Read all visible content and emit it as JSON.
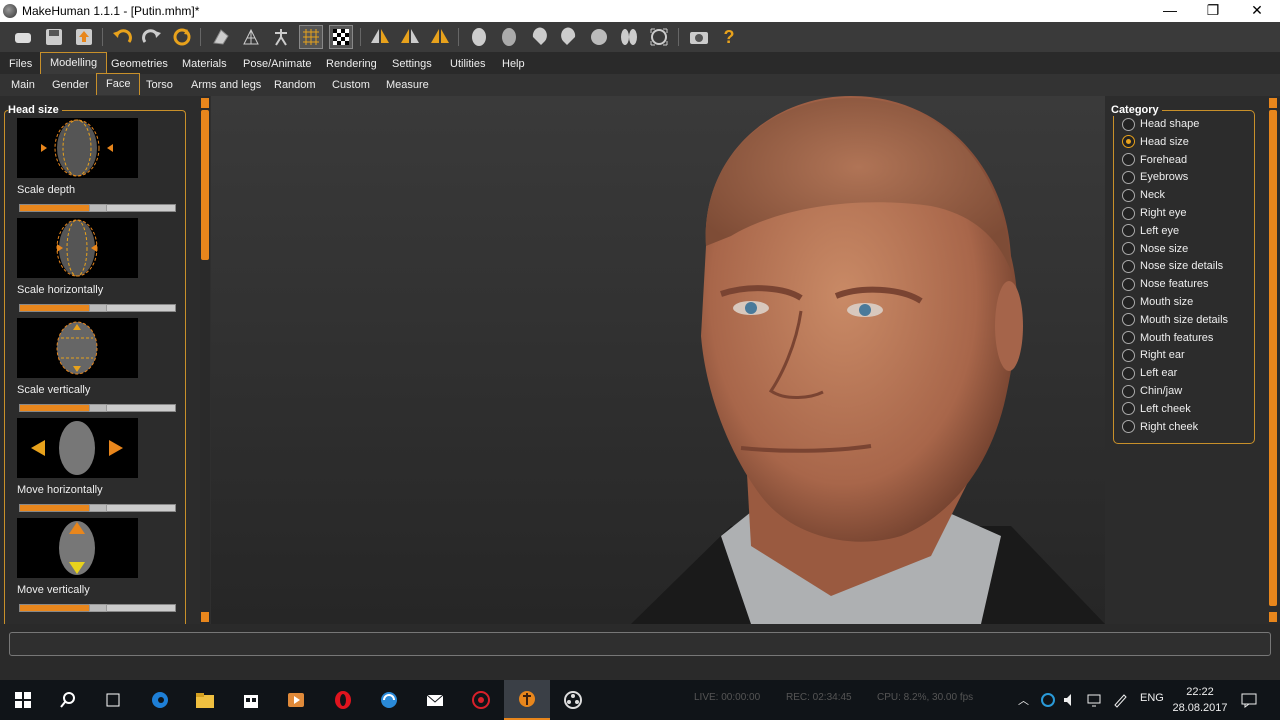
{
  "window": {
    "title": "MakeHuman 1.1.1 - [Putin.mhm]*",
    "minimize": "—",
    "restore": "❐",
    "close": "✕"
  },
  "menu_tabs": [
    {
      "label": "Files"
    },
    {
      "label": "Modelling"
    },
    {
      "label": "Geometries"
    },
    {
      "label": "Materials"
    },
    {
      "label": "Pose/Animate"
    },
    {
      "label": "Rendering"
    },
    {
      "label": "Settings"
    },
    {
      "label": "Utilities"
    },
    {
      "label": "Help"
    }
  ],
  "active_menu_tab": "Modelling",
  "sub_tabs": [
    {
      "label": "Main"
    },
    {
      "label": "Gender"
    },
    {
      "label": "Face"
    },
    {
      "label": "Torso"
    },
    {
      "label": "Arms and legs"
    },
    {
      "label": "Random"
    },
    {
      "label": "Custom"
    },
    {
      "label": "Measure"
    }
  ],
  "active_sub_tab": "Face",
  "left_panel": {
    "title": "Head size",
    "sliders": [
      {
        "label": "Scale depth",
        "value": 0.5
      },
      {
        "label": "Scale horizontally",
        "value": 0.5
      },
      {
        "label": "Scale vertically",
        "value": 0.5
      },
      {
        "label": "Move horizontally",
        "value": 0.5
      },
      {
        "label": "Move vertically",
        "value": 0.5
      }
    ]
  },
  "right_panel": {
    "title": "Category",
    "selected": "Head size",
    "items": [
      {
        "label": "Head shape"
      },
      {
        "label": "Head size"
      },
      {
        "label": "Forehead"
      },
      {
        "label": "Eyebrows"
      },
      {
        "label": "Neck"
      },
      {
        "label": "Right eye"
      },
      {
        "label": "Left eye"
      },
      {
        "label": "Nose size"
      },
      {
        "label": "Nose size details"
      },
      {
        "label": "Nose features"
      },
      {
        "label": "Mouth size"
      },
      {
        "label": "Mouth size details"
      },
      {
        "label": "Mouth features"
      },
      {
        "label": "Right ear"
      },
      {
        "label": "Left ear"
      },
      {
        "label": "Chin/jaw"
      },
      {
        "label": "Left cheek"
      },
      {
        "label": "Right cheek"
      }
    ]
  },
  "toolbar": {
    "help": "?"
  },
  "taskbar": {
    "live": "LIVE: 00:00:00",
    "rec": "REC: 02:34:45",
    "cpu": "CPU: 8.2%, 30.00 fps",
    "lang": "ENG",
    "time": "22:22",
    "date": "28.08.2017"
  },
  "colors": {
    "accent": "#e8861c",
    "frame": "#c8902a"
  }
}
